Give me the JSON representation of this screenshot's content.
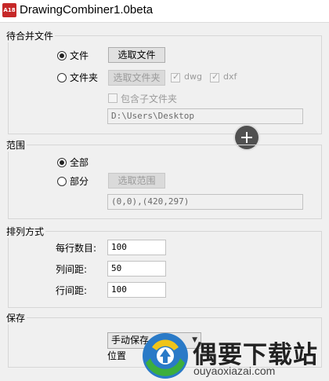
{
  "window": {
    "icon_text": "A18",
    "title": "DrawingCombiner1.0beta"
  },
  "files_group": {
    "label": "待合并文件",
    "radio_file_label": "文件",
    "select_file_button": "选取文件",
    "radio_folder_label": "文件夹",
    "select_folder_button": "选取文件夹",
    "dwg_label": "dwg",
    "dxf_label": "dxf",
    "include_subfolders_label": "包含子文件夹",
    "path_value": "D:\\Users\\Desktop"
  },
  "range_group": {
    "label": "范围",
    "radio_all_label": "全部",
    "radio_part_label": "部分",
    "select_range_button": "选取范围",
    "range_value": "(0,0),(420,297)"
  },
  "layout_group": {
    "label": "排列方式",
    "per_row_label": "每行数目:",
    "per_row_value": "100",
    "col_spacing_label": "列间距:",
    "col_spacing_value": "50",
    "row_spacing_label": "行间距:",
    "row_spacing_value": "100"
  },
  "save_group": {
    "label": "保存",
    "save_mode_value": "手动保存",
    "location_label": "位置"
  },
  "watermark": {
    "brand": "偶要下载站",
    "url": "ouyaoxiazai.com"
  },
  "icons": [
    "autocad-app-icon",
    "plus-circle-icon",
    "chevron-down-icon",
    "watermark-logo-icon"
  ]
}
